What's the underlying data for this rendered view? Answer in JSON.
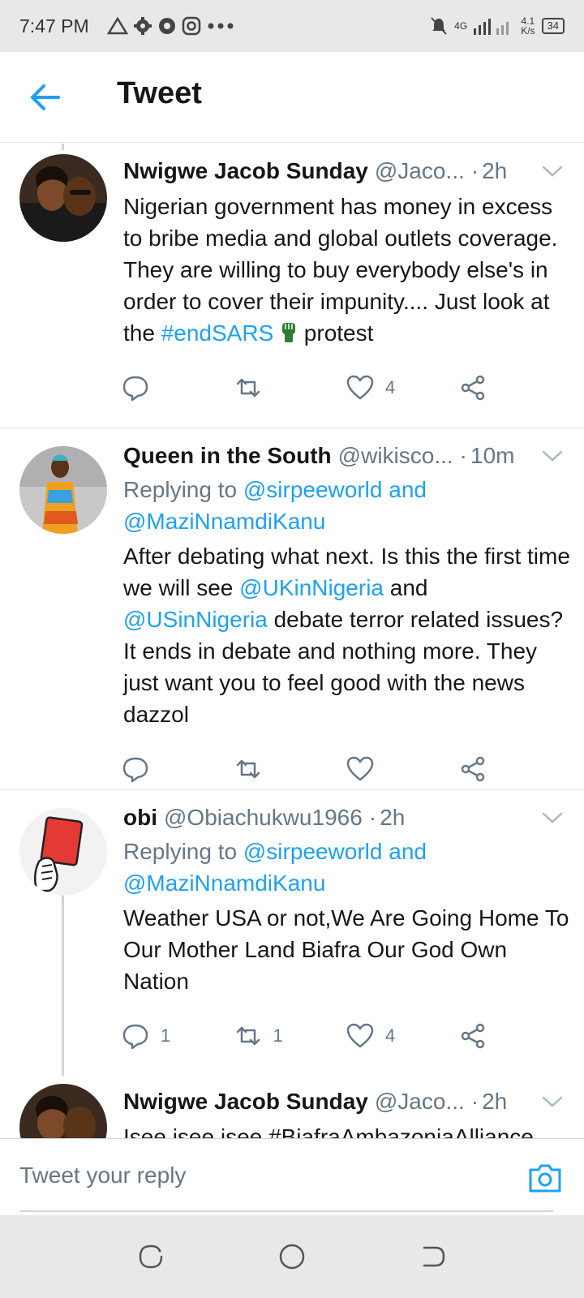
{
  "status_bar": {
    "time": "7:47 PM",
    "signal": "4G",
    "speed_value": "4.1",
    "speed_unit": "K/s",
    "battery": "34"
  },
  "header": {
    "title": "Tweet"
  },
  "tweets": [
    {
      "name": "Nwigwe Jacob Sunday",
      "handle": "@Jaco...",
      "time": "2h",
      "text_before": "Nigerian government has money in excess to bribe media and global outlets coverage. They are willing to buy everybody else's in order to cover their impunity.... Just look at the ",
      "hashtag": "#endSARS",
      "text_after": " protest",
      "replies": "",
      "retweets": "",
      "likes": "4"
    },
    {
      "name": "Queen in the South",
      "handle": "@wikisco...",
      "time": "10m",
      "replying_label": "Replying to",
      "replying_to_1": "@sirpeeworld",
      "replying_and": "and",
      "replying_to_2": "@MaziNnamdiKanu",
      "text_1": "After debating what next. Is this the first time we will see ",
      "mention_1": "@UKinNigeria",
      "text_2": " and ",
      "mention_2": "@USinNigeria",
      "text_3": " debate terror related issues? It ends in debate and nothing more. They just want you to feel good with the news dazzol",
      "replies": "",
      "retweets": "",
      "likes": ""
    },
    {
      "name": "obi",
      "handle": "@Obiachukwu1966",
      "time": "2h",
      "replying_label": "Replying to",
      "replying_to_1": "@sirpeeworld",
      "replying_and": "and",
      "replying_to_2": "@MaziNnamdiKanu",
      "text": "Weather USA or not,We Are Going Home To Our Mother Land Biafra Our God Own Nation",
      "replies": "1",
      "retweets": "1",
      "likes": "4"
    },
    {
      "name": "Nwigwe Jacob Sunday",
      "handle": "@Jaco...",
      "time": "2h",
      "text_partial": "Isee isee isee #BiafraAmbazoniaAlliance"
    }
  ],
  "reply_bar": {
    "placeholder": "Tweet your reply"
  },
  "colors": {
    "accent": "#1da1f2",
    "muted": "#657786",
    "text": "#14171a"
  }
}
